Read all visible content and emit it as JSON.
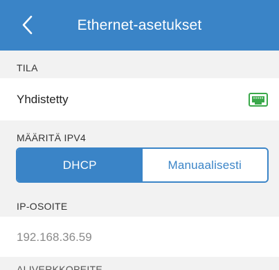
{
  "header": {
    "title": "Ethernet-asetukset",
    "back_icon": "chevron-left-icon"
  },
  "status_section": {
    "label": "TILA",
    "value": "Yhdistetty",
    "icon": "ethernet-port-icon",
    "icon_color": "#3aa84a"
  },
  "ipv4_section": {
    "label": "MÄÄRITÄ IPV4",
    "options": [
      "DHCP",
      "Manuaalisesti"
    ],
    "selected": "DHCP"
  },
  "ip_section": {
    "label": "IP-OSOITE",
    "value": "192.168.36.59"
  },
  "next_section": {
    "label": "ALIVERKKOPEITE"
  },
  "colors": {
    "accent": "#3a84c7",
    "background": "#f2f2f2",
    "row_background": "#ffffff",
    "value_text": "#222222",
    "readonly_text": "#8a8a8a"
  }
}
